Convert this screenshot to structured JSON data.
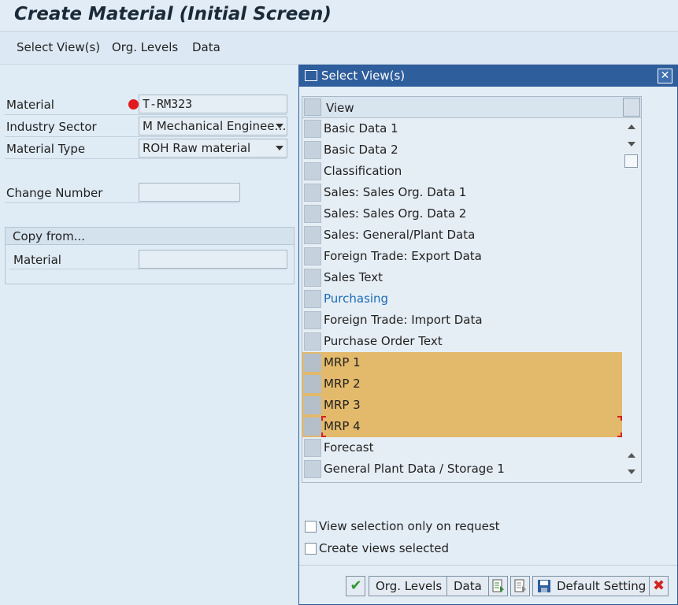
{
  "window": {
    "title": "Create Material (Initial Screen)"
  },
  "menu": {
    "items": [
      "Select View(s)",
      "Org. Levels",
      "Data"
    ]
  },
  "form": {
    "material_label": "Material",
    "material_value": "T-RM323",
    "industry_label": "Industry Sector",
    "industry_value": "M Mechanical Enginee…",
    "material_type_label": "Material Type",
    "material_type_value": "ROH Raw material",
    "change_number_label": "Change Number",
    "change_number_value": "",
    "copy_from_title": "Copy from...",
    "copy_material_label": "Material",
    "copy_material_value": ""
  },
  "dialog": {
    "title": "Select View(s)",
    "column_header": "View",
    "views": [
      {
        "label": "Basic Data 1",
        "selected": false,
        "link": false
      },
      {
        "label": "Basic Data 2",
        "selected": false,
        "link": false
      },
      {
        "label": "Classification",
        "selected": false,
        "link": false
      },
      {
        "label": "Sales: Sales Org. Data 1",
        "selected": false,
        "link": false
      },
      {
        "label": "Sales: Sales Org. Data 2",
        "selected": false,
        "link": false
      },
      {
        "label": "Sales: General/Plant Data",
        "selected": false,
        "link": false
      },
      {
        "label": "Foreign Trade: Export Data",
        "selected": false,
        "link": false
      },
      {
        "label": "Sales Text",
        "selected": false,
        "link": false
      },
      {
        "label": "Purchasing",
        "selected": false,
        "link": true
      },
      {
        "label": "Foreign Trade: Import Data",
        "selected": false,
        "link": false
      },
      {
        "label": "Purchase Order Text",
        "selected": false,
        "link": false
      },
      {
        "label": "MRP 1",
        "selected": true,
        "link": false
      },
      {
        "label": "MRP 2",
        "selected": true,
        "link": false
      },
      {
        "label": "MRP 3",
        "selected": true,
        "link": false
      },
      {
        "label": "MRP 4",
        "selected": true,
        "link": false
      },
      {
        "label": "Forecast",
        "selected": false,
        "link": false
      },
      {
        "label": "General Plant Data / Storage 1",
        "selected": false,
        "link": false
      }
    ],
    "option_view_on_request": "View selection only on request",
    "option_create_selected": "Create views selected",
    "buttons": {
      "org_levels": "Org. Levels",
      "data": "Data",
      "default_setting": "Default Setting"
    }
  },
  "colors": {
    "dialog_header": "#2f5e9c",
    "selected_row": "#e3b96b",
    "required": "#e0191f"
  }
}
